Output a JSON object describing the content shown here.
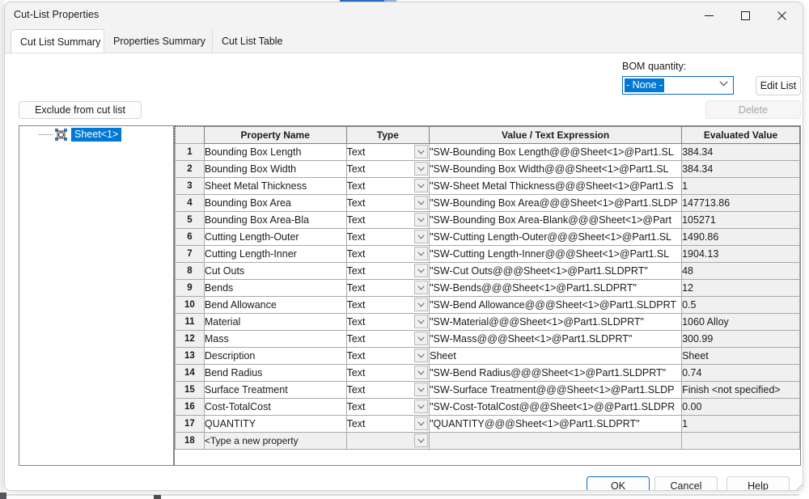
{
  "window": {
    "title": "Cut-List Properties",
    "minimize_icon": "minimize-icon",
    "maximize_icon": "maximize-icon",
    "close_icon": "close-icon"
  },
  "tabs": [
    {
      "label": "Cut List Summary",
      "active": true
    },
    {
      "label": "Properties Summary",
      "active": false
    },
    {
      "label": "Cut List Table",
      "active": false
    }
  ],
  "bom": {
    "label": "BOM quantity:",
    "selected": "- None -",
    "dropdown_icon": "chevron-down-icon",
    "edit_list_label": "Edit List",
    "delete_label": "Delete"
  },
  "left": {
    "exclude_label": "Exclude from cut list",
    "tree_icon": "cut-list-item-icon",
    "tree_item": "Sheet<1>"
  },
  "grid": {
    "headers": {
      "number": "",
      "property_name": "Property Name",
      "type": "Type",
      "value": "Value / Text Expression",
      "evaluated": "Evaluated Value"
    },
    "rows": [
      {
        "n": "1",
        "name": "Bounding Box Length",
        "type": "Text",
        "value": "\"SW-Bounding Box Length@@@Sheet<1>@Part1.SL",
        "eval": "384.34"
      },
      {
        "n": "2",
        "name": "Bounding Box Width",
        "type": "Text",
        "value": "\"SW-Bounding Box Width@@@Sheet<1>@Part1.SL",
        "eval": "384.34"
      },
      {
        "n": "3",
        "name": "Sheet Metal Thickness",
        "type": "Text",
        "value": "\"SW-Sheet Metal Thickness@@@Sheet<1>@Part1.S",
        "eval": "1"
      },
      {
        "n": "4",
        "name": "Bounding Box Area",
        "type": "Text",
        "value": "\"SW-Bounding Box Area@@@Sheet<1>@Part1.SLDP",
        "eval": "147713.86"
      },
      {
        "n": "5",
        "name": "Bounding Box Area-Bla",
        "type": "Text",
        "value": "\"SW-Bounding Box Area-Blank@@@Sheet<1>@Part",
        "eval": "105271"
      },
      {
        "n": "6",
        "name": "Cutting Length-Outer",
        "type": "Text",
        "value": "\"SW-Cutting Length-Outer@@@Sheet<1>@Part1.SL",
        "eval": "1490.86"
      },
      {
        "n": "7",
        "name": "Cutting Length-Inner",
        "type": "Text",
        "value": "\"SW-Cutting Length-Inner@@@Sheet<1>@Part1.SL",
        "eval": "1904.13"
      },
      {
        "n": "8",
        "name": "Cut Outs",
        "type": "Text",
        "value": "\"SW-Cut Outs@@@Sheet<1>@Part1.SLDPRT\"",
        "eval": "48"
      },
      {
        "n": "9",
        "name": "Bends",
        "type": "Text",
        "value": "\"SW-Bends@@@Sheet<1>@Part1.SLDPRT\"",
        "eval": "12"
      },
      {
        "n": "10",
        "name": "Bend Allowance",
        "type": "Text",
        "value": "\"SW-Bend Allowance@@@Sheet<1>@Part1.SLDPRT",
        "eval": "0.5"
      },
      {
        "n": "11",
        "name": "Material",
        "type": "Text",
        "value": "\"SW-Material@@@Sheet<1>@Part1.SLDPRT\"",
        "eval": "1060 Alloy"
      },
      {
        "n": "12",
        "name": "Mass",
        "type": "Text",
        "value": "\"SW-Mass@@@Sheet<1>@Part1.SLDPRT\"",
        "eval": "300.99"
      },
      {
        "n": "13",
        "name": "Description",
        "type": "Text",
        "value": "Sheet",
        "eval": "Sheet"
      },
      {
        "n": "14",
        "name": "Bend Radius",
        "type": "Text",
        "value": "\"SW-Bend Radius@@@Sheet<1>@Part1.SLDPRT\"",
        "eval": "0.74"
      },
      {
        "n": "15",
        "name": "Surface Treatment",
        "type": "Text",
        "value": "\"SW-Surface Treatment@@@Sheet<1>@Part1.SLDP",
        "eval": "Finish <not specified>"
      },
      {
        "n": "16",
        "name": "Cost-TotalCost",
        "type": "Text",
        "value": "\"SW-Cost-TotalCost@@@Sheet<1>@@Part1.SLDPR",
        "eval": "0.00"
      },
      {
        "n": "17",
        "name": "QUANTITY",
        "type": "Text",
        "value": "\"QUANTITY@@@Sheet<1>@Part1.SLDPRT\"",
        "eval": "1"
      },
      {
        "n": "18",
        "name": "<Type a new property",
        "type": "",
        "value": "",
        "eval": "",
        "isnew": true
      }
    ]
  },
  "footer": {
    "ok_label": "OK",
    "cancel_label": "Cancel",
    "help_label": "Help"
  },
  "colors": {
    "accent": "#0078d4",
    "focus_border": "#0f6cbd",
    "dialog_bg": "#f0f0f0",
    "grid_border": "#a9a9a9"
  }
}
